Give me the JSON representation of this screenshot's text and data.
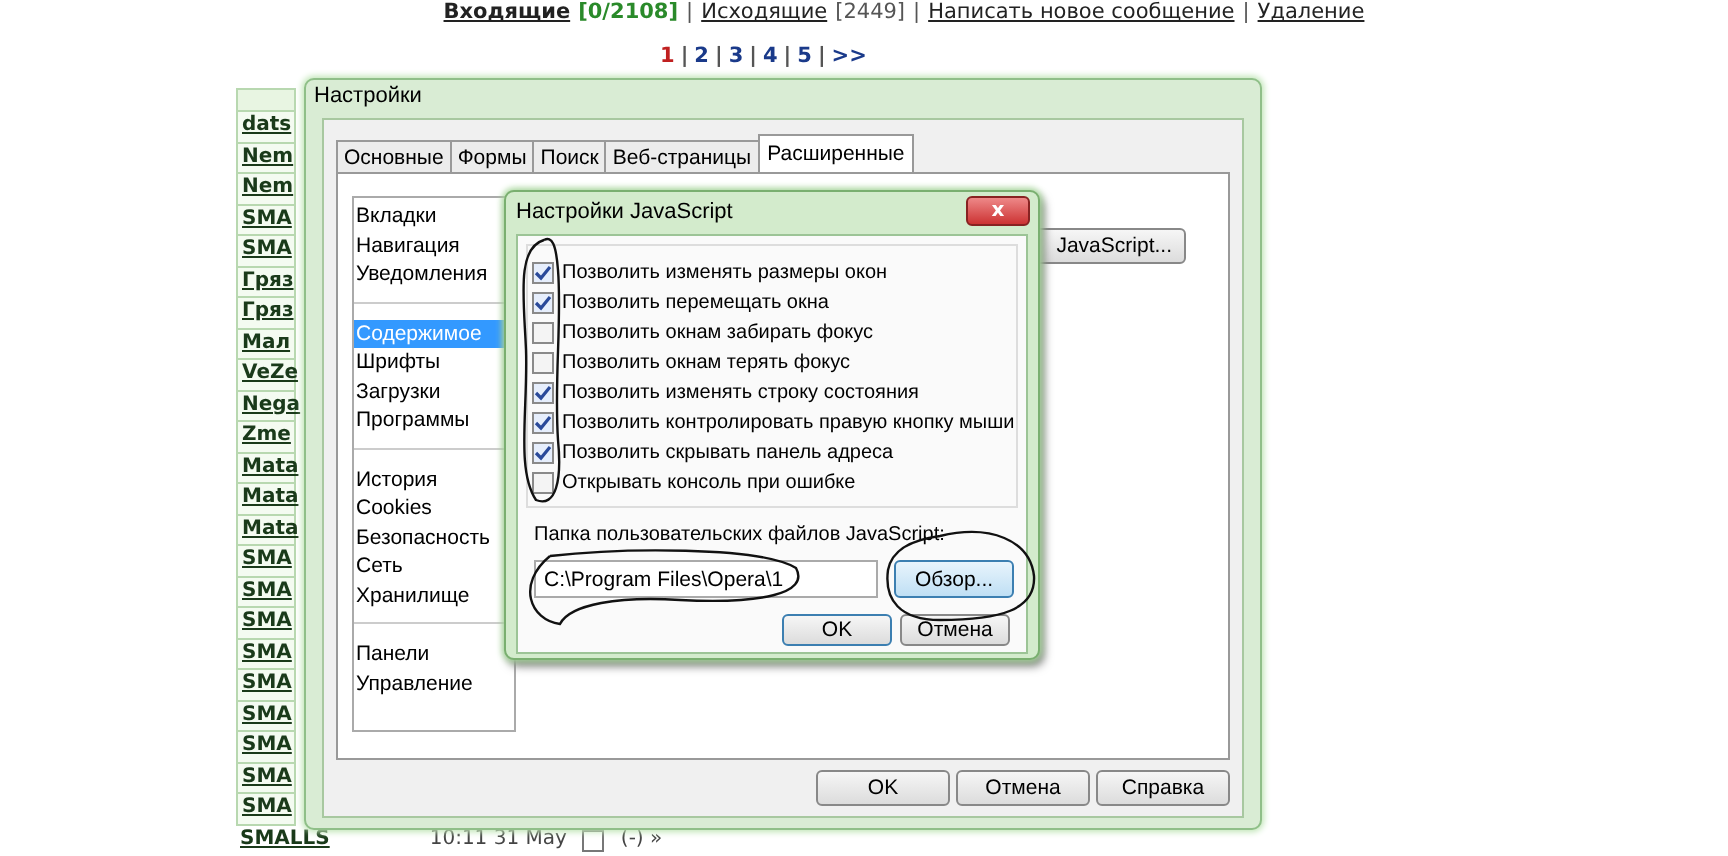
{
  "page": {
    "separator": "|",
    "nav": [
      {
        "label": "Входящие",
        "count": "[0/2108]",
        "bold": true
      },
      {
        "label": "Исходящие",
        "count": "[2449]",
        "bold": false
      },
      {
        "label": "Написать новое сообщение",
        "bold": false
      },
      {
        "label": "Удаление",
        "bold": false
      }
    ],
    "pagination": [
      {
        "label": "1",
        "selected": true
      },
      {
        "label": "2",
        "selected": false
      },
      {
        "label": "3",
        "selected": false
      },
      {
        "label": "4",
        "selected": false
      },
      {
        "label": "5",
        "selected": false
      },
      {
        "label": ">>",
        "selected": false
      }
    ],
    "list_rows": [
      "dats",
      "Nem",
      "Nem",
      "SMA",
      "SMA",
      "Гряз",
      "Гряз",
      "Мал",
      "VeZe",
      "Nega",
      "Zme",
      "Mata",
      "Mata",
      "Mata",
      "SMA",
      "SMA",
      "SMA",
      "SMA",
      "SMA",
      "SMA",
      "SMA",
      "SMA",
      "SMA"
    ],
    "last_row": {
      "name": "SMALLS",
      "time": "10:11 31 May",
      "checked": false,
      "action": "(-) »"
    }
  },
  "settings": {
    "title": "Настройки",
    "tabs": [
      {
        "label": "Основные",
        "selected": false
      },
      {
        "label": "Формы",
        "selected": false
      },
      {
        "label": "Поиск",
        "selected": false
      },
      {
        "label": "Веб-страницы",
        "selected": false
      },
      {
        "label": "Расширенные",
        "selected": true
      }
    ],
    "sidebar": {
      "groups": [
        [
          {
            "label": "Вкладки",
            "selected": false
          },
          {
            "label": "Навигация",
            "selected": false
          },
          {
            "label": "Уведомления",
            "selected": false
          }
        ],
        [
          {
            "label": "Содержимое",
            "selected": true
          },
          {
            "label": "Шрифты",
            "selected": false
          },
          {
            "label": "Загрузки",
            "selected": false
          },
          {
            "label": "Программы",
            "selected": false
          }
        ],
        [
          {
            "label": "История",
            "selected": false
          },
          {
            "label": "Cookies",
            "selected": false
          },
          {
            "label": "Безопасность",
            "selected": false
          },
          {
            "label": "Сеть",
            "selected": false
          },
          {
            "label": "Хранилище",
            "selected": false
          }
        ],
        [
          {
            "label": "Панели",
            "selected": false
          },
          {
            "label": "Управление",
            "selected": false
          }
        ]
      ]
    },
    "javascript_button": "JavaScript...",
    "buttons": [
      "OK",
      "Отмена",
      "Справка"
    ]
  },
  "js_dialog": {
    "title": "Настройки JavaScript",
    "close": "x",
    "options": [
      {
        "label": "Позволить изменять размеры окон",
        "checked": true
      },
      {
        "label": "Позволить перемещать окна",
        "checked": true
      },
      {
        "label": "Позволить окнам забирать фокус",
        "checked": false
      },
      {
        "label": "Позволить окнам терять фокус",
        "checked": false
      },
      {
        "label": "Позволить изменять строку состояния",
        "checked": true
      },
      {
        "label": "Позволить контролировать правую кнопку мыши",
        "checked": true
      },
      {
        "label": "Позволить скрывать панель адреса",
        "checked": true
      },
      {
        "label": "Открывать консоль при ошибке",
        "checked": false
      }
    ],
    "folder_label": "Папка пользовательских файлов JavaScript:",
    "folder_value": "C:\\Program Files\\Opera\\1",
    "browse_button": "Обзор...",
    "buttons": [
      "OK",
      "Отмена"
    ]
  }
}
